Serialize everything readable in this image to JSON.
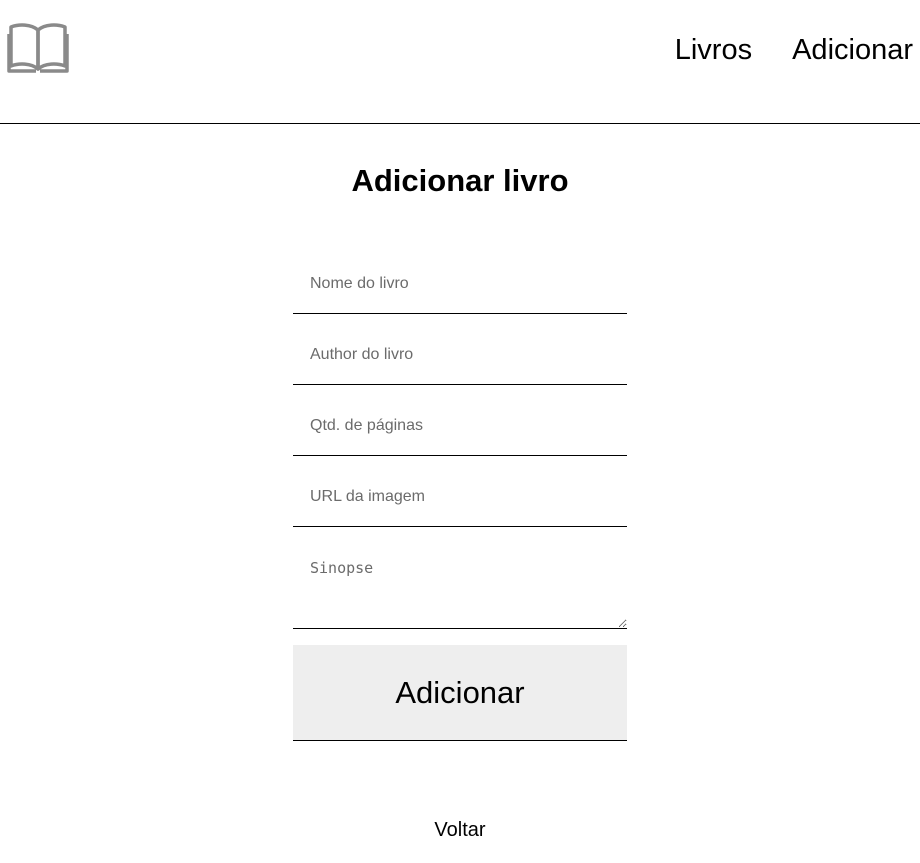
{
  "header": {
    "logo_icon": "open-book-icon",
    "logo_color": "#8a8a8a",
    "nav": {
      "books_label": "Livros",
      "add_label": "Adicionar"
    }
  },
  "main": {
    "title": "Adicionar livro",
    "form": {
      "name_placeholder": "Nome do livro",
      "author_placeholder": "Author do livro",
      "pages_placeholder": "Qtd. de páginas",
      "image_url_placeholder": "URL da imagem",
      "synopsis_placeholder": "Sinopse",
      "submit_label": "Adicionar",
      "submit_bg": "#eeeeee"
    },
    "back_label": "Voltar"
  }
}
